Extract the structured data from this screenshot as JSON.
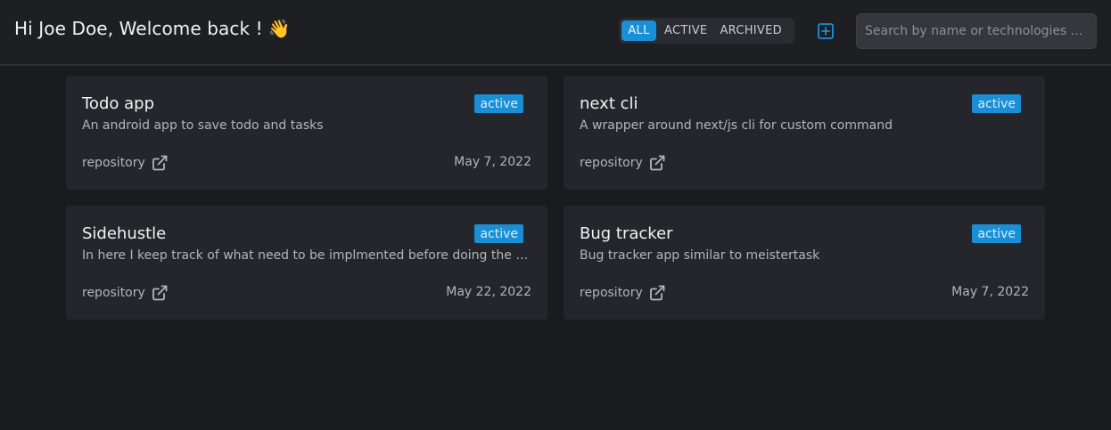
{
  "header": {
    "greeting": "Hi Joe Doe, Welcome back !",
    "wave_emoji": "👋",
    "filters": [
      {
        "label": "ALL",
        "active": true
      },
      {
        "label": "ACTIVE",
        "active": false
      },
      {
        "label": "ARCHIVED",
        "active": false
      }
    ],
    "add_icon": "plus-square-icon",
    "search_placeholder": "Search by name or technologies ..."
  },
  "accent_color": "#1a8fd6",
  "projects": [
    {
      "title": "Todo app",
      "status": "active",
      "description": "An android app to save todo and tasks",
      "repo_label": "repository",
      "date": "May 7, 2022"
    },
    {
      "title": "next cli",
      "status": "active",
      "description": "A wrapper around next/js cli for custom command",
      "repo_label": "repository",
      "date": ""
    },
    {
      "title": "Sidehustle",
      "status": "active",
      "description": "In here I keep track of what need to be implmented before doing the big launch of the product",
      "repo_label": "repository",
      "date": "May 22, 2022"
    },
    {
      "title": "Bug tracker",
      "status": "active",
      "description": "Bug tracker app similar to meistertask",
      "repo_label": "repository",
      "date": "May 7, 2022"
    }
  ]
}
